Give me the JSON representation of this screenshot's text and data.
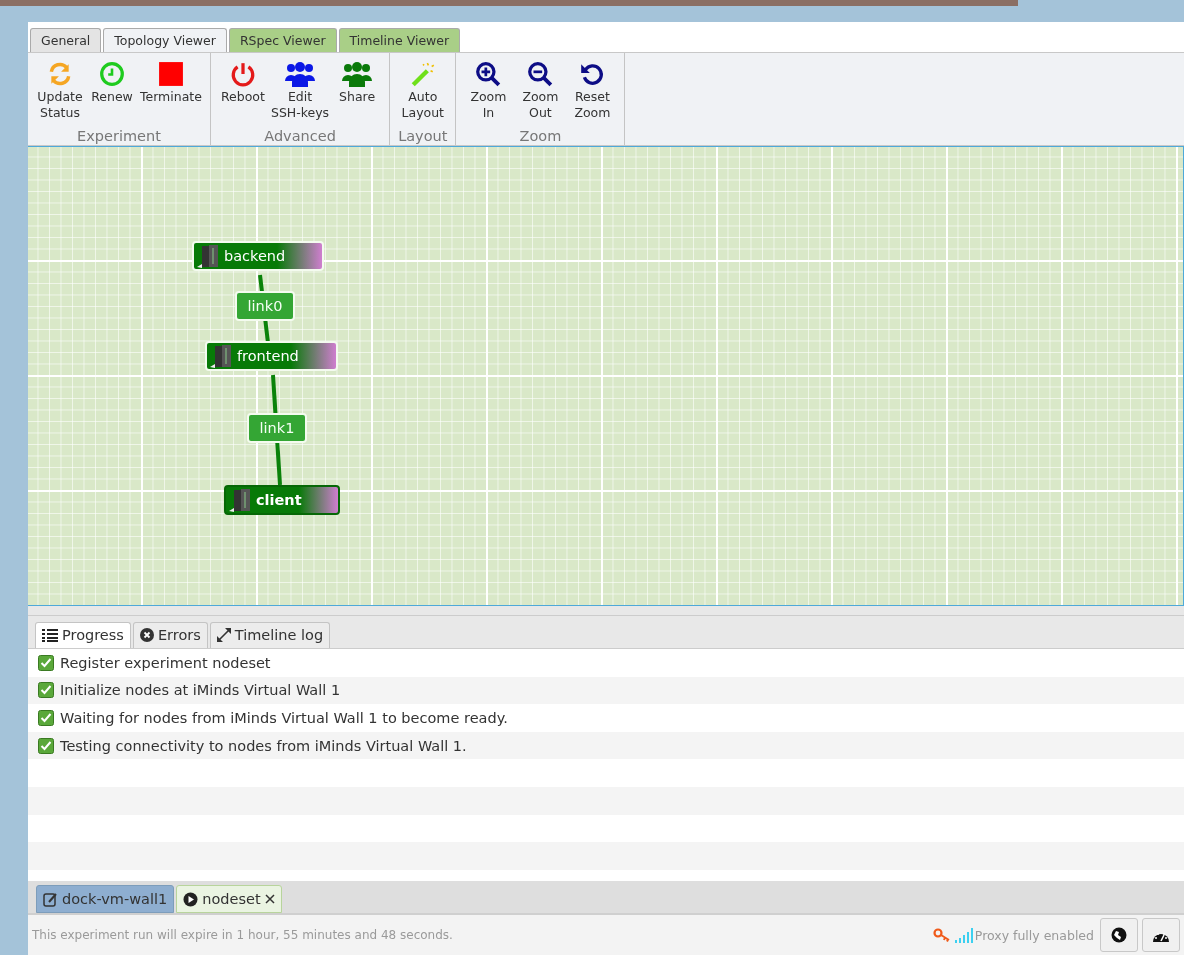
{
  "tabs": [
    {
      "label": "General",
      "selected": false
    },
    {
      "label": "Topology Viewer",
      "selected": true
    },
    {
      "label": "RSpec Viewer",
      "selected": false
    },
    {
      "label": "Timeline Viewer",
      "selected": false
    }
  ],
  "toolbar": [
    {
      "title": "Experiment",
      "buttons": [
        {
          "kind": "refresh",
          "label": "Update\nStatus"
        },
        {
          "kind": "clock",
          "label": "Renew"
        },
        {
          "kind": "stop",
          "label": "Terminate"
        }
      ]
    },
    {
      "title": "Advanced",
      "buttons": [
        {
          "kind": "power",
          "label": "Reboot"
        },
        {
          "kind": "users-blue",
          "label": "Edit\nSSH-keys"
        },
        {
          "kind": "users-green",
          "label": "Share"
        }
      ]
    },
    {
      "title": "Layout",
      "buttons": [
        {
          "kind": "wand",
          "label": "Auto\nLayout"
        }
      ]
    },
    {
      "title": "Zoom",
      "buttons": [
        {
          "kind": "zoom-in",
          "label": "Zoom\nIn"
        },
        {
          "kind": "zoom-out",
          "label": "Zoom\nOut"
        },
        {
          "kind": "reset",
          "label": "Reset\nZoom"
        }
      ]
    }
  ],
  "topology": [
    {
      "kind": "node",
      "label": "backend",
      "selected": false
    },
    {
      "kind": "link",
      "label": "link0"
    },
    {
      "kind": "node",
      "label": "frontend",
      "selected": false
    },
    {
      "kind": "link",
      "label": "link1"
    },
    {
      "kind": "node",
      "label": "client",
      "selected": true
    }
  ],
  "log_tabs": [
    {
      "kind": "list",
      "label": "Progress",
      "selected": true
    },
    {
      "kind": "error",
      "label": "Errors",
      "selected": false
    },
    {
      "kind": "expand",
      "label": "Timeline log",
      "selected": false
    }
  ],
  "log_rows": [
    {
      "text": "Register experiment nodeset",
      "done": true
    },
    {
      "text": "Initialize nodes at iMinds Virtual Wall 1",
      "done": true
    },
    {
      "text": "Waiting for nodes from iMinds Virtual Wall 1 to become ready.",
      "done": true
    },
    {
      "text": "Testing connectivity to nodes from iMinds Virtual Wall 1.",
      "done": true
    }
  ],
  "doc_tabs": [
    {
      "kind": "edit",
      "label": "dock-vm-wall1",
      "selected": false,
      "closable": false
    },
    {
      "kind": "play",
      "label": "nodeset",
      "selected": true,
      "closable": true
    }
  ],
  "status_bar": {
    "message": "This experiment run will expire in 1 hour, 55 minutes and 48 seconds.",
    "proxy": "Proxy fully enabled"
  }
}
